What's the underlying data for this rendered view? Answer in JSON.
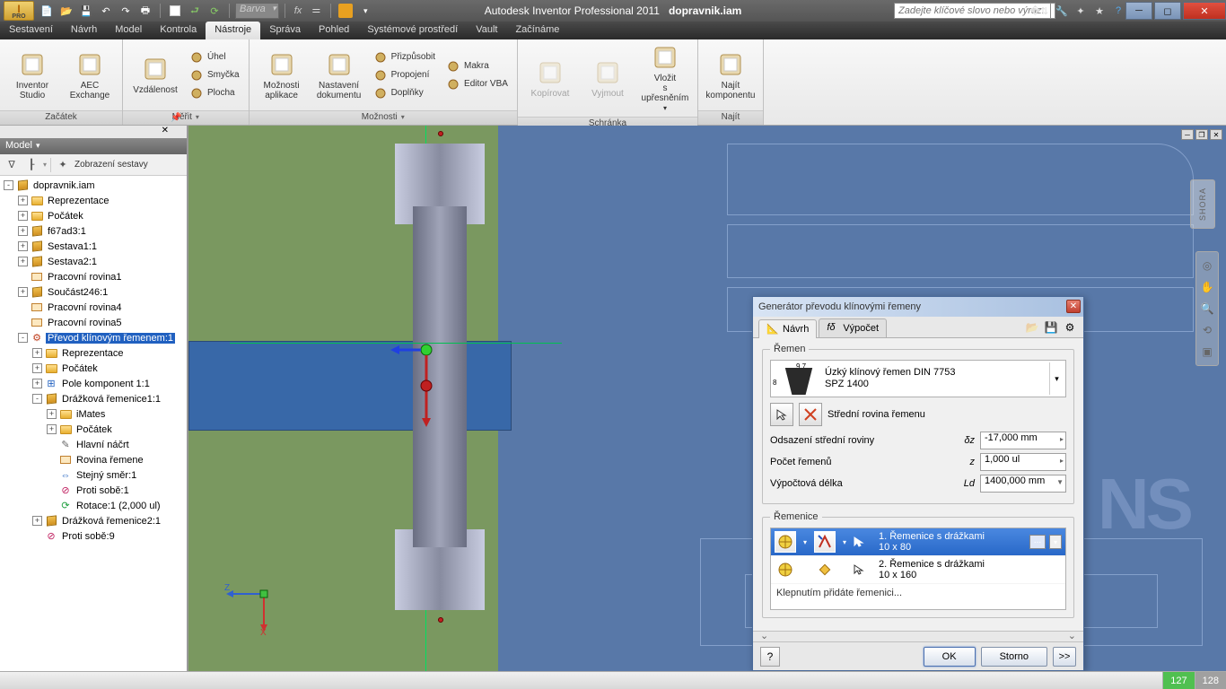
{
  "app": {
    "name": "Autodesk Inventor Professional 2011",
    "doc": "dopravnik.iam",
    "pro": "PRO"
  },
  "qat": {
    "color_combo": "Barva",
    "fx": "fx"
  },
  "search_placeholder": "Zadejte klíčové slovo nebo výraz.",
  "menu": [
    "Sestavení",
    "Návrh",
    "Model",
    "Kontrola",
    "Nástroje",
    "Správa",
    "Pohled",
    "Systémové prostředí",
    "Vault",
    "Začínáme"
  ],
  "menu_active": 4,
  "ribbon": {
    "panels": [
      {
        "label": "Začátek",
        "items": [
          {
            "t": "big",
            "label": "Inventor\nStudio"
          },
          {
            "t": "big",
            "label": "AEC\nExchange"
          }
        ]
      },
      {
        "label": "Měřit",
        "dd": true,
        "items": [
          {
            "t": "big",
            "label": "Vzdálenost"
          }
        ],
        "side": [
          {
            "label": "Úhel"
          },
          {
            "label": "Smyčka"
          },
          {
            "label": "Plocha"
          }
        ]
      },
      {
        "label": "Možnosti",
        "dd": true,
        "items": [
          {
            "t": "big",
            "label": "Možnosti\naplikace"
          },
          {
            "t": "big",
            "label": "Nastavení\ndokumentu"
          }
        ],
        "side": [
          {
            "label": "Přizpůsobit"
          },
          {
            "label": "Propojení"
          },
          {
            "label": "Doplňky"
          }
        ],
        "side2": [
          {
            "label": "Makra"
          },
          {
            "label": "Editor VBA"
          }
        ]
      },
      {
        "label": "Schránka",
        "items": [
          {
            "t": "big",
            "label": "Kopírovat",
            "disabled": true
          },
          {
            "t": "big",
            "label": "Vyjmout",
            "disabled": true
          },
          {
            "t": "big",
            "label": "Vložit\ns upřesněním",
            "dd": true
          }
        ]
      },
      {
        "label": "Najít",
        "items": [
          {
            "t": "big",
            "label": "Najít\nkomponentu"
          }
        ]
      }
    ]
  },
  "browser": {
    "title": "Model",
    "view_label": "Zobrazení sestavy",
    "tree": [
      {
        "d": 0,
        "exp": "-",
        "icon": "asm",
        "name": "dopravnik.iam"
      },
      {
        "d": 1,
        "exp": "+",
        "icon": "folder",
        "name": "Reprezentace"
      },
      {
        "d": 1,
        "exp": "+",
        "icon": "folder",
        "name": "Počátek"
      },
      {
        "d": 1,
        "exp": "+",
        "icon": "cube",
        "name": "f67ad3:1"
      },
      {
        "d": 1,
        "exp": "+",
        "icon": "cube",
        "name": "Sestava1:1"
      },
      {
        "d": 1,
        "exp": "+",
        "icon": "cube",
        "name": "Sestava2:1"
      },
      {
        "d": 1,
        "exp": " ",
        "icon": "plane",
        "name": "Pracovní rovina1"
      },
      {
        "d": 1,
        "exp": "+",
        "icon": "cube",
        "name": "Součást246:1"
      },
      {
        "d": 1,
        "exp": " ",
        "icon": "plane",
        "name": "Pracovní rovina4"
      },
      {
        "d": 1,
        "exp": " ",
        "icon": "plane",
        "name": "Pracovní rovina5"
      },
      {
        "d": 1,
        "exp": "-",
        "icon": "gear",
        "name": "Převod klínovým řemenem:1",
        "sel": true
      },
      {
        "d": 2,
        "exp": "+",
        "icon": "folder",
        "name": "Reprezentace"
      },
      {
        "d": 2,
        "exp": "+",
        "icon": "folder",
        "name": "Počátek"
      },
      {
        "d": 2,
        "exp": "+",
        "icon": "pattern",
        "name": "Pole komponent 1:1"
      },
      {
        "d": 2,
        "exp": "-",
        "icon": "cube",
        "name": "Drážková řemenice1:1"
      },
      {
        "d": 3,
        "exp": "+",
        "icon": "folder",
        "name": "iMates"
      },
      {
        "d": 3,
        "exp": "+",
        "icon": "folder",
        "name": "Počátek"
      },
      {
        "d": 3,
        "exp": " ",
        "icon": "sketch",
        "name": "Hlavní náčrt"
      },
      {
        "d": 3,
        "exp": " ",
        "icon": "plane",
        "name": "Rovina řemene"
      },
      {
        "d": 3,
        "exp": " ",
        "icon": "mate",
        "name": "Stejný směr:1"
      },
      {
        "d": 3,
        "exp": " ",
        "icon": "against",
        "name": "Proti sobě:1"
      },
      {
        "d": 3,
        "exp": " ",
        "icon": "rotate",
        "name": "Rotace:1 (2,000 ul)"
      },
      {
        "d": 2,
        "exp": "+",
        "icon": "cube",
        "name": "Drážková řemenice2:1"
      },
      {
        "d": 2,
        "exp": " ",
        "icon": "against",
        "name": "Proti sobě:9"
      }
    ]
  },
  "shora": "SHORA",
  "dialog": {
    "title": "Generátor převodu klínovými řemeny",
    "tabs": [
      {
        "label": "Návrh",
        "active": true
      },
      {
        "label": "Výpočet"
      }
    ],
    "fx": "fδ",
    "belt_group": "Řemen",
    "belt": {
      "sup1": "9,7",
      "sup2": "8",
      "line1": "Úzký klínový řemen DIN 7753",
      "line2": "SPZ 1400"
    },
    "mid_plane_label": "Střední rovina řemenu",
    "rows": [
      {
        "label": "Odsazení střední roviny",
        "sym": "δz",
        "value": "-17,000 mm"
      },
      {
        "label": "Počet řemenů",
        "sym": "z",
        "value": "1,000 ul"
      },
      {
        "label": "Výpočtová délka",
        "sym": "Ld",
        "value": "1400,000 mm",
        "dropdown": true
      }
    ],
    "pulleys_group": "Řemenice",
    "pulleys": [
      {
        "title": "1. Řemenice s drážkami",
        "sub": "10 x 80",
        "sel": true
      },
      {
        "title": "2. Řemenice s drážkami",
        "sub": "10 x 160"
      }
    ],
    "add_text": "Klepnutím přidáte řemenici...",
    "ok": "OK",
    "cancel": "Storno",
    "more": ">>"
  },
  "status": {
    "n1": "127",
    "n2": "128"
  },
  "axes": {
    "x": "X",
    "z": "Z"
  }
}
